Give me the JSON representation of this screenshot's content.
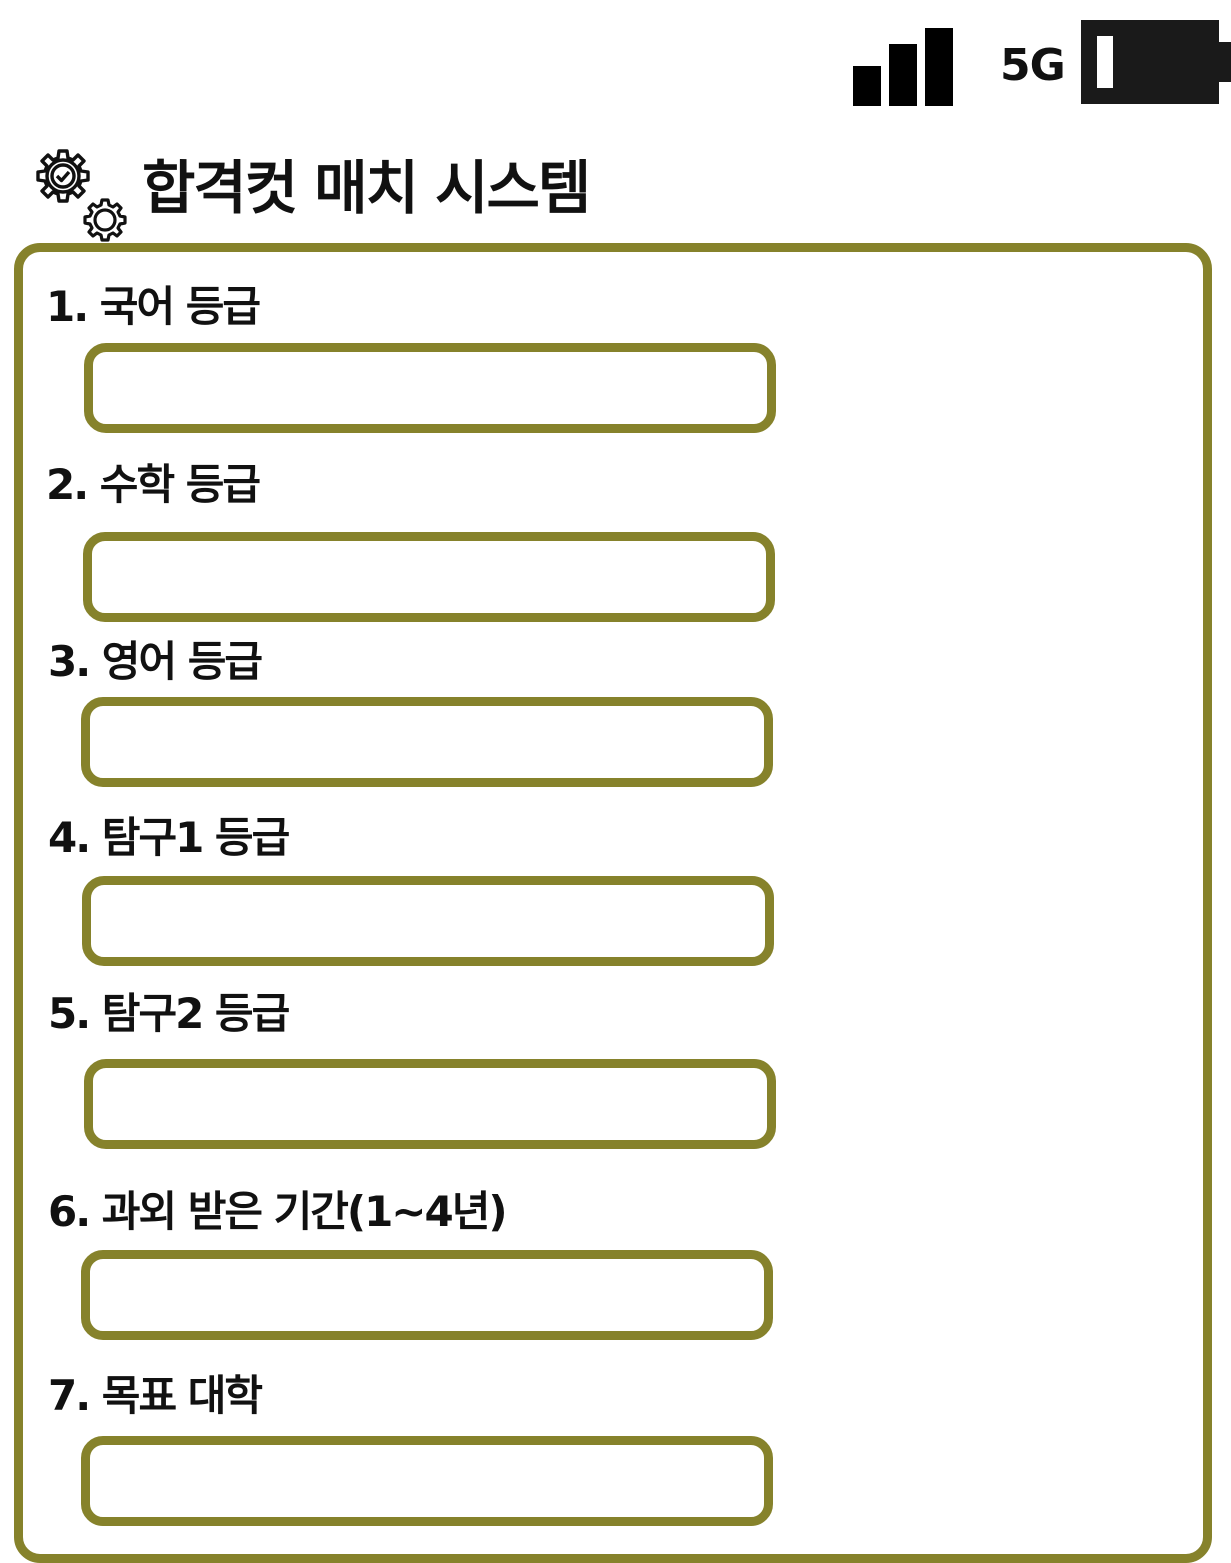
{
  "status_bar": {
    "network": "5G",
    "signal_icon": "signal-bars-icon",
    "battery_icon": "battery-icon",
    "battery_level": 0.15
  },
  "header": {
    "icon": "gear-check-icon",
    "title": "합격컷 매치 시스템"
  },
  "form": {
    "fields": [
      {
        "label": "1. 국어 등급",
        "value": "",
        "placeholder": ""
      },
      {
        "label": "2. 수학 등급",
        "value": "",
        "placeholder": ""
      },
      {
        "label": "3. 영어 등급",
        "value": "",
        "placeholder": ""
      },
      {
        "label": "4. 탐구1 등급",
        "value": "",
        "placeholder": ""
      },
      {
        "label": "5. 탐구2 등급",
        "value": "",
        "placeholder": ""
      },
      {
        "label": "6. 과외 받은 기간(1~4년)",
        "value": "",
        "placeholder": ""
      },
      {
        "label": "7. 목표 대학",
        "value": "",
        "placeholder": ""
      }
    ]
  },
  "colors": {
    "accent": "#86822b",
    "text": "#111111",
    "status_icons": "#000000"
  }
}
